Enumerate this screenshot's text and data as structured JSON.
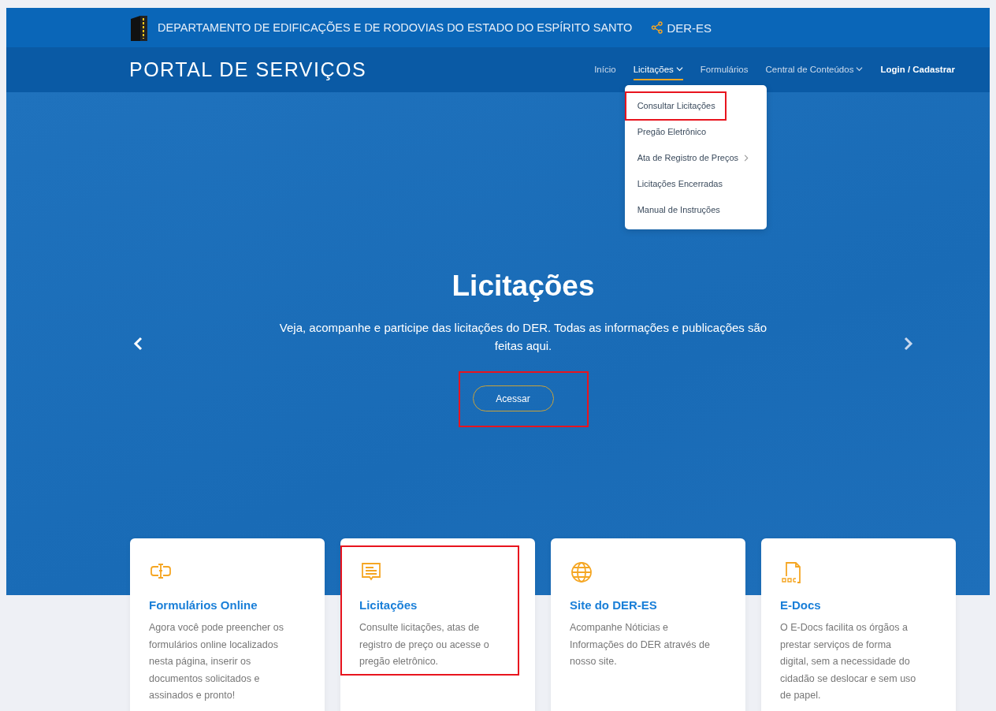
{
  "top_bar": {
    "title": "DEPARTAMENTO DE EDIFICAÇÕES E DE RODOVIAS DO ESTADO DO ESPÍRITO SANTO",
    "share_label": "DER-ES"
  },
  "nav": {
    "brand": "PORTAL DE SERVIÇOS",
    "items": [
      {
        "label": "Início",
        "selected": false,
        "has_menu": false,
        "kind": "link"
      },
      {
        "label": "Licitações",
        "selected": true,
        "has_menu": true,
        "kind": "link"
      },
      {
        "label": "Formulários",
        "selected": false,
        "has_menu": false,
        "kind": "link"
      },
      {
        "label": "Central de Conteúdos",
        "selected": false,
        "has_menu": true,
        "kind": "link"
      },
      {
        "label": "Login / Cadastrar",
        "selected": false,
        "has_menu": false,
        "kind": "login"
      }
    ],
    "dropdown": [
      {
        "label": "Consultar Licitações",
        "has_submenu": false,
        "highlighted": true
      },
      {
        "label": "Pregão Eletrônico",
        "has_submenu": false,
        "highlighted": false
      },
      {
        "label": "Ata de Registro de Preços",
        "has_submenu": true,
        "highlighted": false
      },
      {
        "label": "Licitações Encerradas",
        "has_submenu": false,
        "highlighted": false
      },
      {
        "label": "Manual de Instruções",
        "has_submenu": false,
        "highlighted": false
      }
    ]
  },
  "hero": {
    "title": "Licitações",
    "text": "Veja, acompanhe e participe das licitações do DER. Todas as informações e publicações são feitas aqui.",
    "button": "Acessar",
    "button_highlighted": true
  },
  "cards": [
    {
      "kind": "forms",
      "title": "Formulários Online",
      "text": "Agora você pode preencher os formulários online localizados nesta página, inserir os documentos solicitados e assinados e pronto!",
      "highlighted": false
    },
    {
      "kind": "bids",
      "title": "Licitações",
      "text": "Consulte licitações, atas de registro de preço ou acesse o pregão eletrônico.",
      "highlighted": true
    },
    {
      "kind": "site",
      "title": "Site do DER-ES",
      "text": "Acompanhe Nóticias e Informações do DER através de nosso site.",
      "highlighted": false
    },
    {
      "kind": "doc",
      "title": "E-Docs",
      "text": "O E-Docs facilita os órgãos a prestar serviços de forma digital, sem a necessidade do cidadão se deslocar e sem uso de papel.",
      "highlighted": false
    }
  ]
}
